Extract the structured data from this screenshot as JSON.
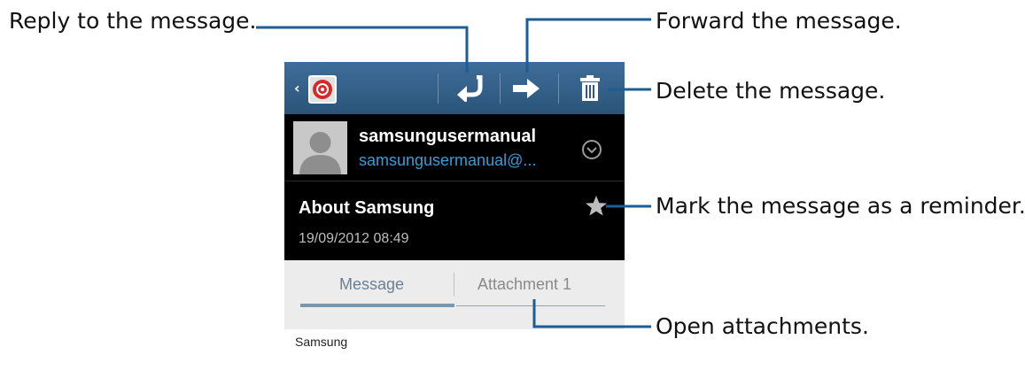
{
  "callouts": {
    "reply": "Reply to the message.",
    "forward": "Forward the message.",
    "delete": "Delete the message.",
    "reminder": "Mark the message as a reminder.",
    "attachments": "Open attachments."
  },
  "action_bar": {
    "back_glyph": "‹",
    "icons": [
      "email-app-icon",
      "reply-icon",
      "forward-icon",
      "delete-icon"
    ],
    "color": "#2f5a82"
  },
  "message": {
    "sender_name": "samsungusermanual",
    "sender_email": "samsungusermanual@...",
    "subject": "About Samsung",
    "date": "19/09/2012 08:49",
    "body": "Samsung"
  },
  "tabs": [
    {
      "label": "Message",
      "active": true
    },
    {
      "label": "Attachment 1",
      "active": false
    }
  ],
  "colors": {
    "callout_line": "#1d5c94",
    "header_bg": "#000000",
    "email_link": "#3b9bd6"
  }
}
